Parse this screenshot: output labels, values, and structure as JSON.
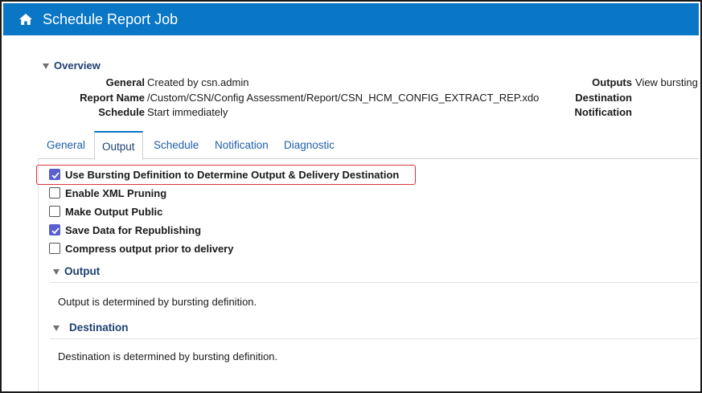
{
  "titlebar": {
    "title": "Schedule Report Job",
    "icon": "home-icon",
    "color": "#0a76c6"
  },
  "overview": {
    "heading": "Overview",
    "left": [
      {
        "label": "General",
        "value": "Created by csn.admin"
      },
      {
        "label": "Report Name",
        "value": "/Custom/CSN/Config Assessment/Report/CSN_HCM_CONFIG_EXTRACT_REP.xdo"
      },
      {
        "label": "Schedule",
        "value": "Start immediately"
      }
    ],
    "right": [
      {
        "label": "Outputs",
        "value": "View bursting"
      },
      {
        "label": "Destination",
        "value": ""
      },
      {
        "label": "Notification",
        "value": ""
      }
    ]
  },
  "tabs": [
    {
      "label": "General",
      "active": false
    },
    {
      "label": "Output",
      "active": true
    },
    {
      "label": "Schedule",
      "active": false
    },
    {
      "label": "Notification",
      "active": false
    },
    {
      "label": "Diagnostic",
      "active": false
    }
  ],
  "options": [
    {
      "label": "Use Bursting Definition to Determine Output & Delivery Destination",
      "checked": true
    },
    {
      "label": "Enable XML Pruning",
      "checked": false
    },
    {
      "label": "Make Output Public",
      "checked": false
    },
    {
      "label": "Save Data for Republishing",
      "checked": true
    },
    {
      "label": "Compress output prior to delivery",
      "checked": false
    }
  ],
  "sections": {
    "output": {
      "heading": "Output",
      "text": "Output is determined by bursting definition."
    },
    "destination": {
      "heading": "Destination",
      "text": "Destination is determined by bursting definition."
    }
  },
  "colors": {
    "highlight": "#d9363e",
    "checkbox": "#5a5fd0"
  }
}
